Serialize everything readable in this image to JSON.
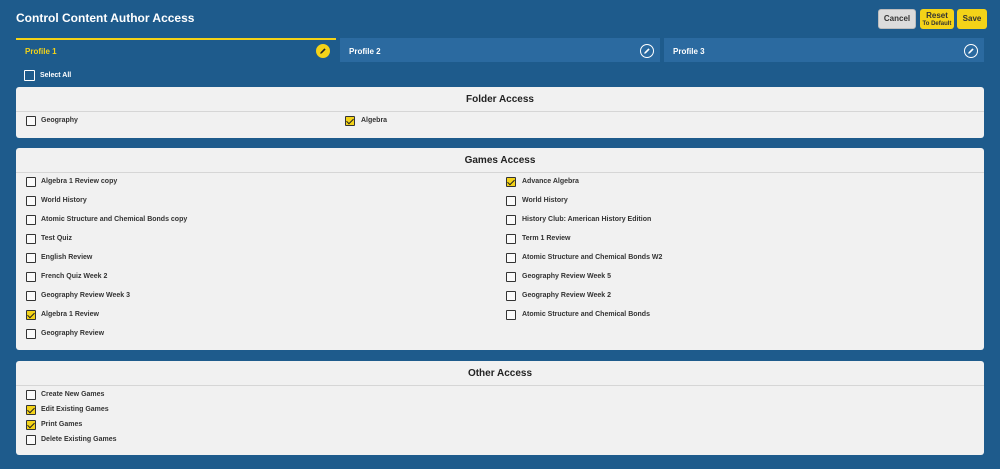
{
  "header": {
    "title": "Control Content Author Access",
    "cancel_label": "Cancel",
    "reset_label": "Reset",
    "reset_sub_label": "To Default",
    "save_label": "Save"
  },
  "tabs": [
    {
      "label": "Profile 1",
      "active": true
    },
    {
      "label": "Profile 2",
      "active": false
    },
    {
      "label": "Profile 3",
      "active": false
    }
  ],
  "select_all": {
    "label": "Select All",
    "checked": false
  },
  "folder_access": {
    "title": "Folder Access",
    "items": [
      {
        "label": "Geography",
        "checked": false
      },
      {
        "label": "Algebra",
        "checked": true
      }
    ]
  },
  "games_access": {
    "title": "Games Access",
    "left": [
      {
        "label": "Algebra 1 Review copy",
        "checked": false
      },
      {
        "label": "World History",
        "checked": false
      },
      {
        "label": "Atomic Structure and Chemical Bonds copy",
        "checked": false
      },
      {
        "label": "Test Quiz",
        "checked": false
      },
      {
        "label": "English Review",
        "checked": false
      },
      {
        "label": "French Quiz Week 2",
        "checked": false
      },
      {
        "label": "Geography Review Week 3",
        "checked": false
      },
      {
        "label": "Algebra 1 Review",
        "checked": true
      },
      {
        "label": "Geography Review",
        "checked": false
      }
    ],
    "right": [
      {
        "label": "Advance Algebra",
        "checked": true
      },
      {
        "label": "World History",
        "checked": false
      },
      {
        "label": "History Club: American History Edition",
        "checked": false
      },
      {
        "label": "Term 1 Review",
        "checked": false
      },
      {
        "label": "Atomic Structure and Chemical Bonds W2",
        "checked": false
      },
      {
        "label": "Geography Review Week 5",
        "checked": false
      },
      {
        "label": "Geography Review Week 2",
        "checked": false
      },
      {
        "label": "Atomic Structure and Chemical Bonds",
        "checked": false
      }
    ]
  },
  "other_access": {
    "title": "Other Access",
    "items": [
      {
        "label": "Create New Games",
        "checked": false
      },
      {
        "label": "Edit Existing Games",
        "checked": true
      },
      {
        "label": "Print Games",
        "checked": true
      },
      {
        "label": "Delete Existing Games",
        "checked": false
      }
    ]
  },
  "colors": {
    "background": "#1e5b8c",
    "accent": "#f4d318",
    "panel": "#f1f1f1"
  }
}
